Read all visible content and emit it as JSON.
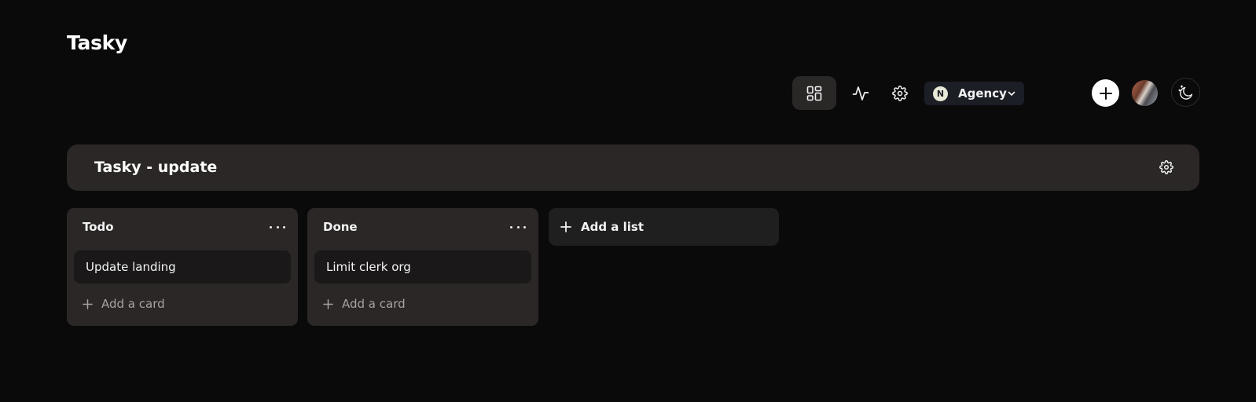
{
  "app": {
    "title": "Tasky"
  },
  "toolbar": {
    "org_name": "Agency",
    "org_logo_letter": "N",
    "icons": [
      "board-icon",
      "activity-icon",
      "gear-icon",
      "chevron-down-icon",
      "plus-icon",
      "avatar",
      "moon-stars-icon"
    ]
  },
  "board": {
    "title": "Tasky - update"
  },
  "lists": [
    {
      "title": "Todo",
      "cards": [
        "Update landing"
      ],
      "add_card_label": "Add a card"
    },
    {
      "title": "Done",
      "cards": [
        "Limit clerk org"
      ],
      "add_card_label": "Add a card"
    }
  ],
  "add_list_label": "Add a list",
  "colors": {
    "background": "#0b0a0a",
    "surface": "#2a2726",
    "card": "#1a1818",
    "org_switch": "#1c1e26",
    "muted_text": "#a7a3a2"
  }
}
